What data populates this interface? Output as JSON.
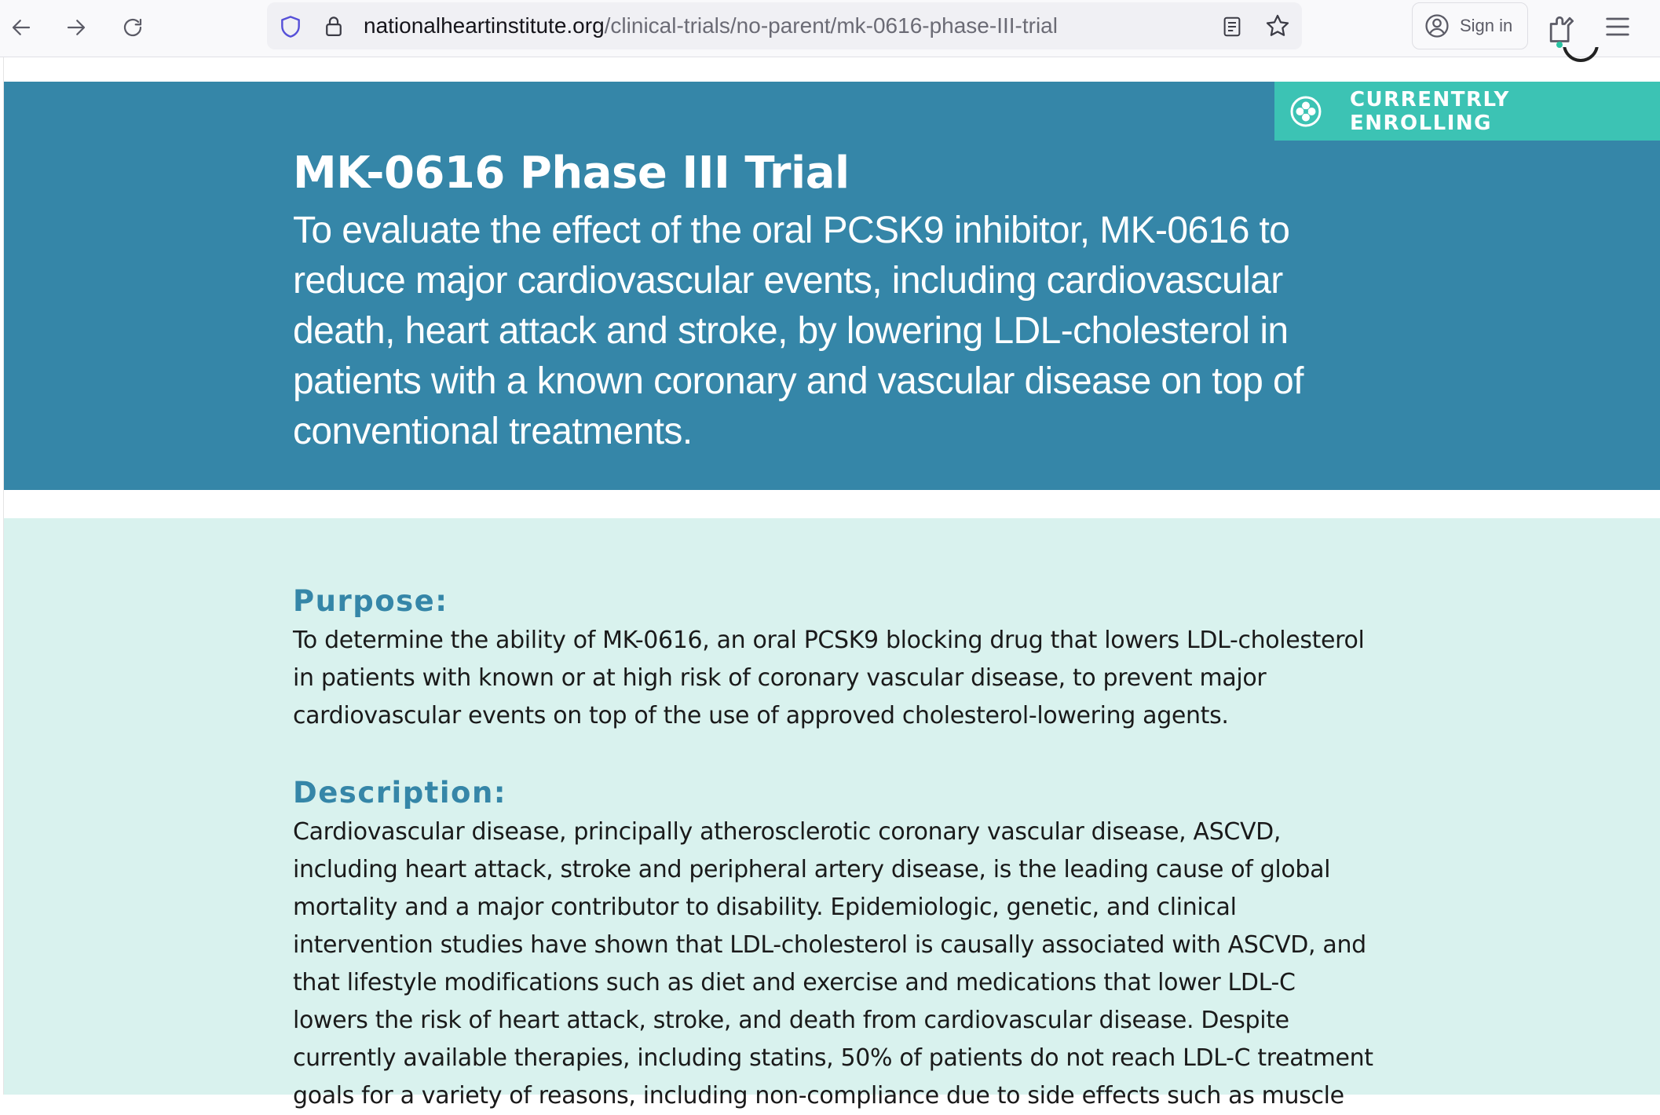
{
  "browser": {
    "url_domain": "nationalheartinstitute.org",
    "url_path": "/clinical-trials/no-parent/mk-0616-phase-III-trial",
    "sign_in_label": "Sign in"
  },
  "badge": {
    "label": "CURRENTRLY ENROLLING",
    "icon": "cross-circle-icon"
  },
  "hero": {
    "title": "MK-0616 Phase III Trial",
    "subtitle": "To evaluate the effect of the oral PCSK9 inhibitor, MK-0616 to reduce major cardiovascular events, including cardiovascular death, heart attack and stroke, by lowering LDL-cholesterol in patients with a known coronary and vascular disease on top of conventional treatments."
  },
  "sections": {
    "purpose": {
      "heading": "Purpose:",
      "body": "To determine the ability of MK-0616, an oral PCSK9 blocking drug that lowers LDL-cholesterol in patients with known or at high risk of coronary vascular disease, to prevent major cardiovascular events on top of the use of approved cholesterol-lowering agents."
    },
    "description": {
      "heading": "Description:",
      "body": "Cardiovascular disease, principally atherosclerotic coronary vascular disease, ASCVD, including heart attack, stroke and peripheral artery disease, is the leading cause of global mortality and a major contributor to disability. Epidemiologic, genetic, and clinical intervention studies have shown that LDL-cholesterol is causally associated with ASCVD, and that lifestyle modifications such as diet and exercise and medications that lower LDL-C lowers the risk of heart attack, stroke, and death from cardiovascular disease. Despite currently available therapies, including statins, 50% of patients do not reach LDL-C treatment goals for a variety of reasons, including non-compliance due to side effects such as muscle"
    }
  },
  "colors": {
    "hero_bg": "#3586a8",
    "badge_bg": "#3cc3b4",
    "content_bg": "#d9f2ee",
    "heading": "#3586a8"
  }
}
